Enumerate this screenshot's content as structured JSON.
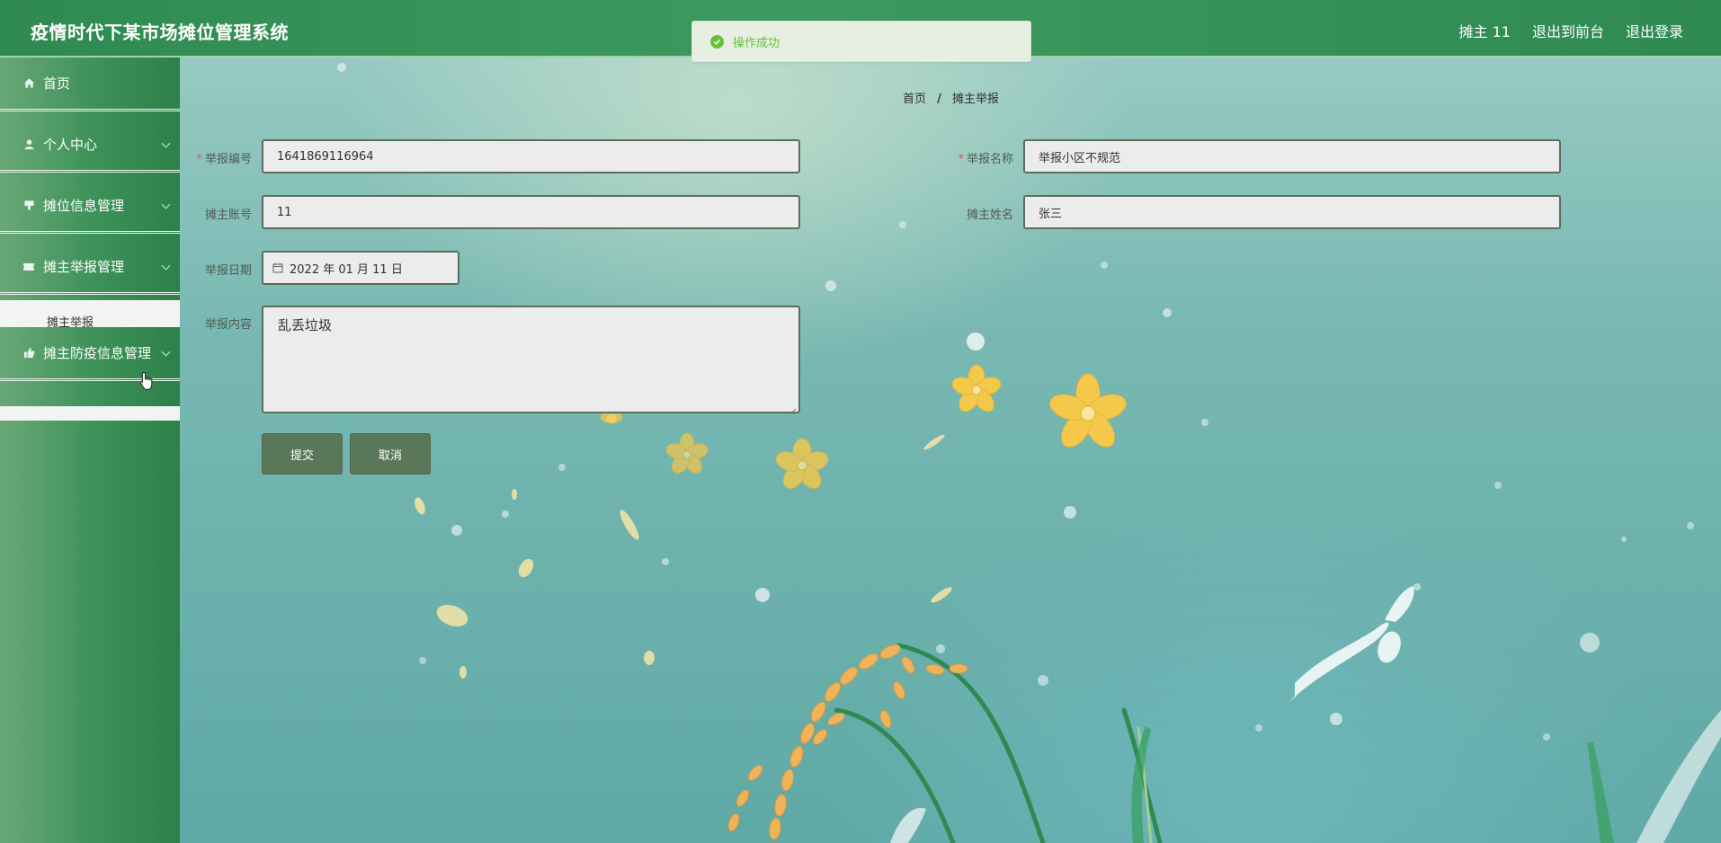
{
  "header": {
    "title": "疫情时代下某市场摊位管理系统",
    "user": "摊主 11",
    "exit_front": "退出到前台",
    "logout": "退出登录"
  },
  "toast": {
    "message": "操作成功"
  },
  "sidebar": {
    "items": [
      {
        "label": "首页",
        "icon": "home-icon"
      },
      {
        "label": "个人中心",
        "icon": "person-icon"
      },
      {
        "label": "摊位信息管理",
        "icon": "stall-icon"
      },
      {
        "label": "摊主举报管理",
        "icon": "ticket-icon"
      },
      {
        "label": "摊主防疫信息管理",
        "icon": "thumb-icon"
      }
    ],
    "submenu_report": "摊主举报"
  },
  "breadcrumb": {
    "home": "首页",
    "current": "摊主举报"
  },
  "form": {
    "report_no_label": "举报编号",
    "report_no_value": "1641869116964",
    "report_name_label": "举报名称",
    "report_name_value": "举报小区不规范",
    "owner_account_label": "摊主账号",
    "owner_account_value": "11",
    "owner_name_label": "摊主姓名",
    "owner_name_value": "张三",
    "report_date_label": "举报日期",
    "report_date_value": "2022 年 01 月 11 日",
    "report_content_label": "举报内容",
    "report_content_value": "乱丢垃圾",
    "submit": "提交",
    "cancel": "取消"
  },
  "colors": {
    "header": "#3d9a5f",
    "button": "#5b7759",
    "success": "#67c23a",
    "required": "#e45656"
  }
}
